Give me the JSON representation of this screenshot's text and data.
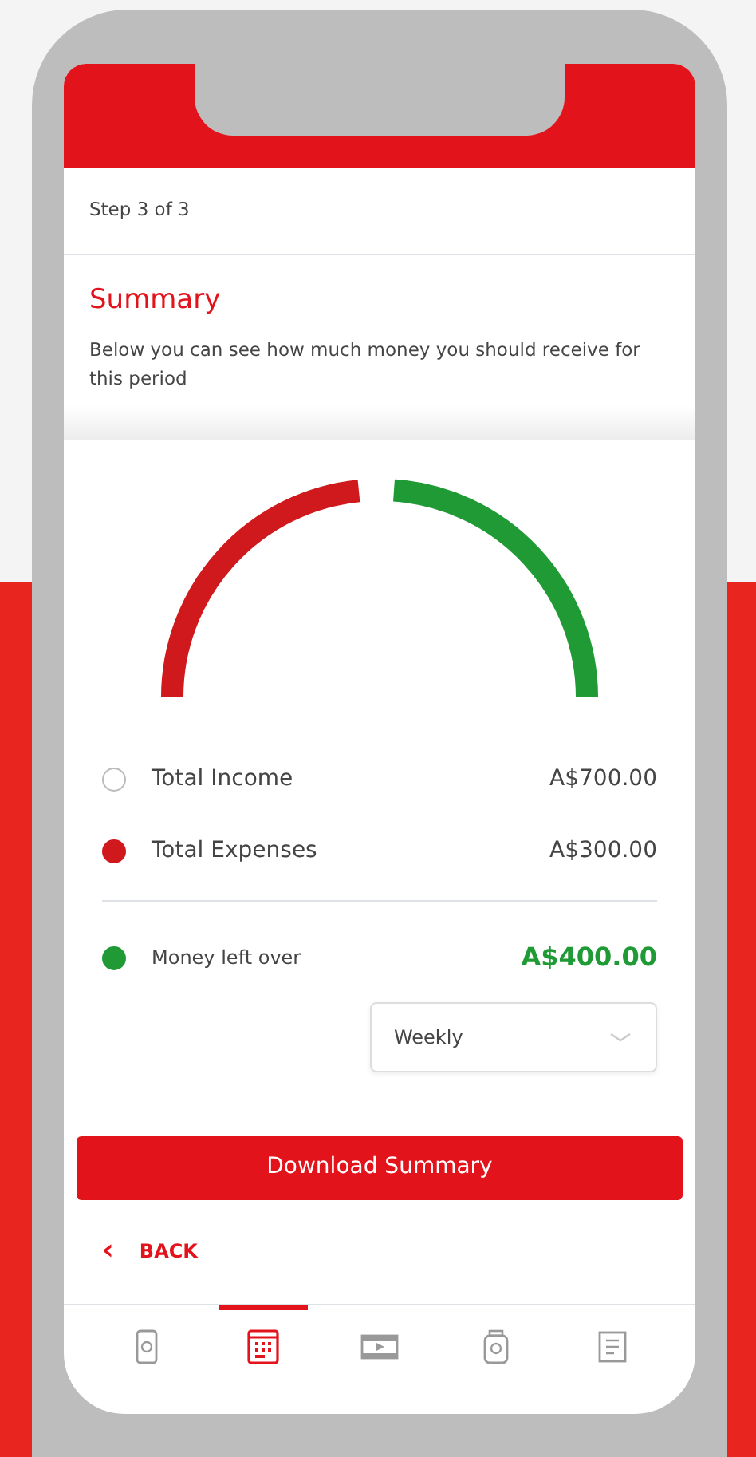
{
  "step": "Step 3 of 3",
  "title": "Summary",
  "description": "Below you can see how much money you should receive for this period",
  "legend": [
    {
      "label": "Total Income",
      "amount": "A$700.00",
      "color": "#ffffff",
      "kind": "row"
    },
    {
      "label": "Total Expenses",
      "amount": "A$300.00",
      "color": "#d0191c",
      "kind": "row"
    },
    {
      "label": "Money left over",
      "amount": "A$400.00",
      "color": "#1f9a35",
      "kind": "total"
    }
  ],
  "period_select": {
    "value": "Weekly"
  },
  "download_button": "Download Summary",
  "back_link": {
    "icon": "‹",
    "label": "BACK"
  },
  "nav_items": [
    {
      "kind": "phone",
      "selected": false
    },
    {
      "kind": "calendar",
      "selected": true
    },
    {
      "kind": "video",
      "selected": false
    },
    {
      "kind": "jar",
      "selected": false
    },
    {
      "kind": "list",
      "selected": false
    }
  ]
}
